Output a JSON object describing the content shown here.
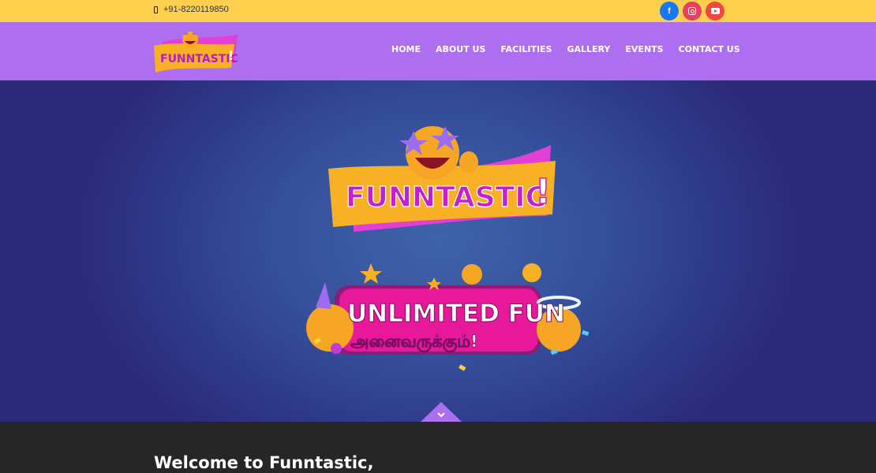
{
  "topbar": {
    "phone": "+91-8220119850",
    "social": [
      "facebook-icon",
      "instagram-icon",
      "youtube-icon"
    ]
  },
  "brand": {
    "logo_text": "FUNNTASTIC",
    "logo_mark": "!"
  },
  "nav": {
    "home": "HOME",
    "about": "ABOUT US",
    "facilities": "FACILITIES",
    "gallery": "GALLERY",
    "events": "EVENTS",
    "contact": "CONTACT US"
  },
  "hero": {
    "banner_line1": "UNLIMITED FUN",
    "banner_line2": "அனைவருக்கும்!"
  },
  "welcome": {
    "heading": "Welcome to Funntastic,"
  },
  "colors": {
    "topbar": "#fccf4d",
    "navbar": "#ad6ff0",
    "footer": "#262626",
    "brand_pink": "#e23fd6",
    "brand_orange": "#f8b024"
  }
}
